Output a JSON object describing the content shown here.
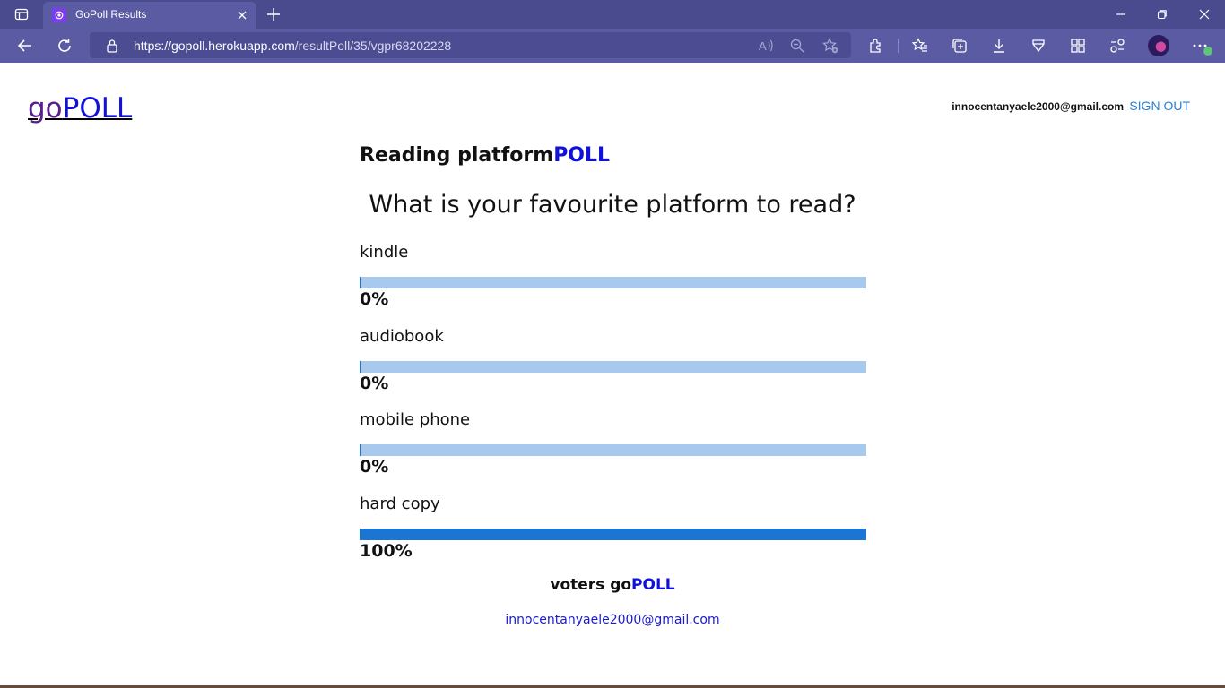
{
  "browser": {
    "tab_title": "GoPoll Results",
    "url_host": "https://gopoll.herokuapp.com",
    "url_path": "/resultPoll/35/vgpr68202228"
  },
  "header": {
    "logo_go": "go",
    "logo_poll": "POLL",
    "user_email": "innocentanyaele2000@gmail.com",
    "signout_label": "SIGN OUT"
  },
  "poll": {
    "title_main": "Reading platform",
    "title_suffix": "POLL",
    "question": "What is your favourite platform to read?",
    "options": [
      {
        "label": "kindle",
        "percent_label": "0%",
        "percent": 0
      },
      {
        "label": "audiobook",
        "percent_label": "0%",
        "percent": 0
      },
      {
        "label": "mobile phone",
        "percent_label": "0%",
        "percent": 0
      },
      {
        "label": "hard copy",
        "percent_label": "100%",
        "percent": 100
      }
    ]
  },
  "voters": {
    "heading_prefix": "voters go",
    "heading_suffix": "POLL",
    "list": [
      "innocentanyaele2000@gmail.com"
    ]
  },
  "colors": {
    "chrome_tabstrip": "#4a4a8e",
    "chrome_toolbar": "#5b5ba4",
    "brand_purple": "#5a1e8c",
    "brand_blue": "#1010d8",
    "bar_track": "#a8c9ee",
    "bar_fill": "#1a76d2",
    "link_blue": "#2a7fd6"
  }
}
